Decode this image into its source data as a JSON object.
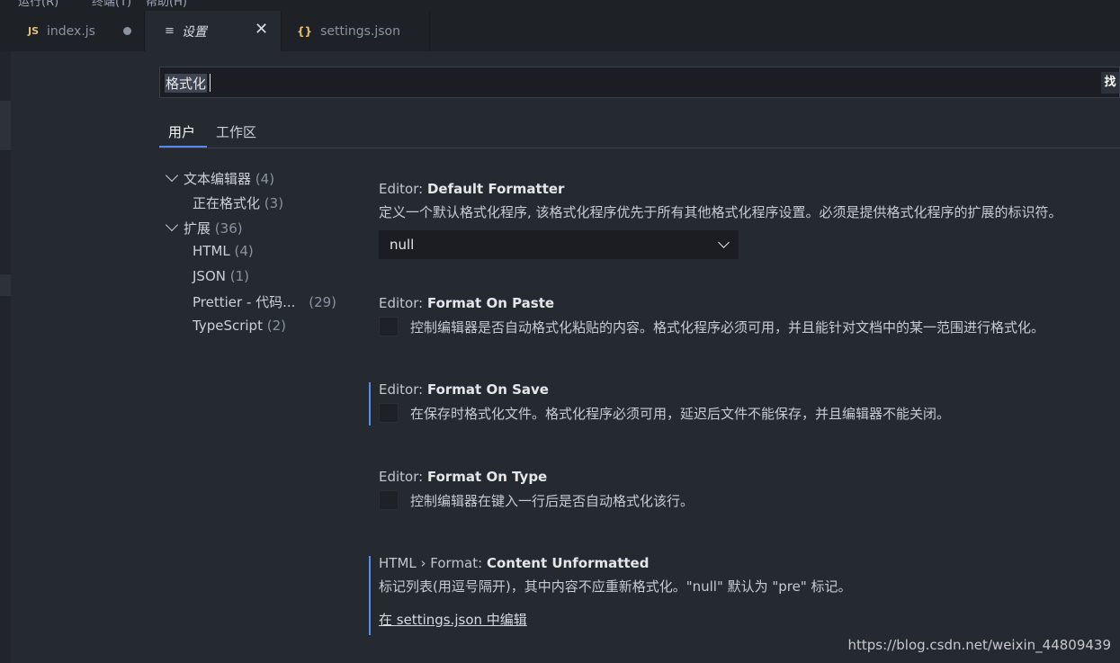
{
  "menubar": {
    "items": [
      "运行(R)",
      "终端(T)",
      "帮助(H)"
    ]
  },
  "tabs": [
    {
      "icon": "javascript-file-icon",
      "icon_text": "JS",
      "label": "index.js",
      "modified": true
    },
    {
      "icon": "settings-lines-icon",
      "icon_text": "≡",
      "label": "设置",
      "close_glyph": "✕",
      "active": true
    },
    {
      "icon": "json-braces-icon",
      "icon_text": "{}",
      "label": "settings.json"
    }
  ],
  "search": {
    "value": "格式化",
    "side_button": "找"
  },
  "scope_tabs": {
    "user": "用户",
    "workspace": "工作区"
  },
  "toc": [
    {
      "label": "文本编辑器",
      "count": "(4)",
      "expanded": true,
      "level": 0
    },
    {
      "label": "正在格式化",
      "count": "(3)",
      "level": 1
    },
    {
      "label": "扩展",
      "count": "(36)",
      "expanded": true,
      "level": 0
    },
    {
      "label": "HTML",
      "count": "(4)",
      "level": 1
    },
    {
      "label": "JSON",
      "count": "(1)",
      "level": 1
    },
    {
      "label": "Prettier - 代码...",
      "count": "(29)",
      "level": 1
    },
    {
      "label": "TypeScript",
      "count": "(2)",
      "level": 1
    }
  ],
  "settings": {
    "default_formatter": {
      "category": "Editor: ",
      "name": "Default Formatter",
      "description": "定义一个默认格式化程序, 该格式化程序优先于所有其他格式化程序设置。必须是提供格式化程序的扩展的标识符。",
      "value": "null"
    },
    "format_on_paste": {
      "category": "Editor: ",
      "name": "Format On Paste",
      "description": "控制编辑器是否自动格式化粘贴的内容。格式化程序必须可用，并且能针对文档中的某一范围进行格式化。",
      "checked": false
    },
    "format_on_save": {
      "category": "Editor: ",
      "name": "Format On Save",
      "description": "在保存时格式化文件。格式化程序必须可用，延迟后文件不能保存，并且编辑器不能关闭。",
      "checked": false
    },
    "format_on_type": {
      "category": "Editor: ",
      "name": "Format On Type",
      "description": "控制编辑器在键入一行后是否自动格式化该行。",
      "checked": false
    },
    "content_unformatted": {
      "category": "HTML › Format: ",
      "name": "Content Unformatted",
      "description": "标记列表(用逗号隔开)，其中内容不应重新格式化。\"null\" 默认为 \"pre\" 标记。",
      "edit_link": "在 settings.json 中编辑"
    }
  },
  "watermark": "https://blog.csdn.net/weixin_44809439",
  "colors": {
    "accent": "#568af2",
    "background": "#252a31",
    "tabbar": "#1e2227",
    "js_icon": "#e5c07b"
  }
}
